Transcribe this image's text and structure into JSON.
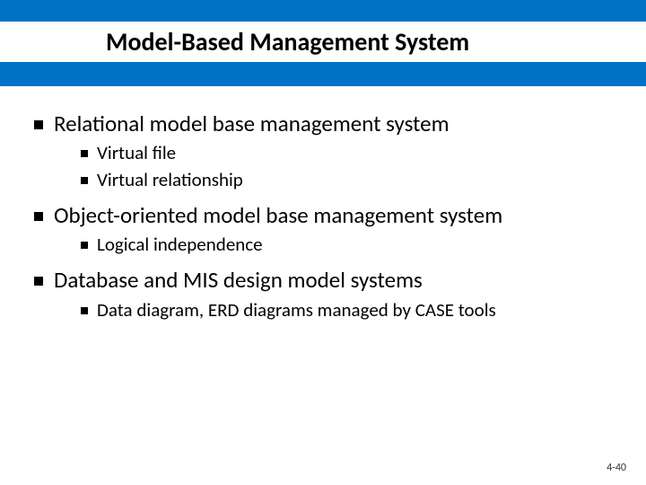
{
  "title": "Model-Based Management System",
  "bullets": [
    {
      "text": "Relational model base management system",
      "sub": [
        {
          "text": "Virtual file"
        },
        {
          "text": "Virtual relationship"
        }
      ]
    },
    {
      "text": "Object-oriented model base management system",
      "sub": [
        {
          "text": "Logical independence"
        }
      ]
    },
    {
      "text": "Database and MIS design model systems",
      "sub": [
        {
          "text": "Data diagram, ERD diagrams managed by CASE tools"
        }
      ]
    }
  ],
  "page_number": "4-40"
}
